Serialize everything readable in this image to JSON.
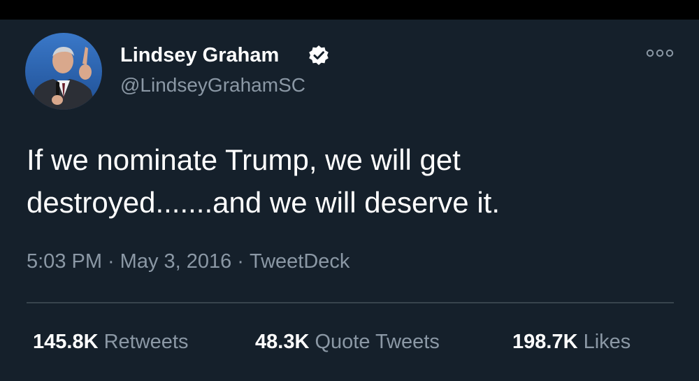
{
  "author": {
    "name": "Lindsey Graham",
    "handle": "@LindseyGrahamSC",
    "verified": true
  },
  "tweet": {
    "line1": "If we nominate Trump, we will get",
    "line2": "destroyed.......and we will deserve it."
  },
  "meta": {
    "time": "5:03 PM",
    "date": "May 3, 2016",
    "source": "TweetDeck",
    "separator": "·"
  },
  "stats": {
    "retweets_count": "145.8K",
    "retweets_label": "Retweets",
    "quotes_count": "48.3K",
    "quotes_label": "Quote Tweets",
    "likes_count": "198.7K",
    "likes_label": "Likes"
  },
  "colors": {
    "background": "#15202b",
    "top_bar": "#000000",
    "primary_text": "#ffffff",
    "secondary_text": "#8b98a5",
    "divider": "#38444d",
    "verified_badge": "#ffffff"
  },
  "icons": {
    "verified": "verified-badge-icon",
    "more": "more-options-icon"
  }
}
